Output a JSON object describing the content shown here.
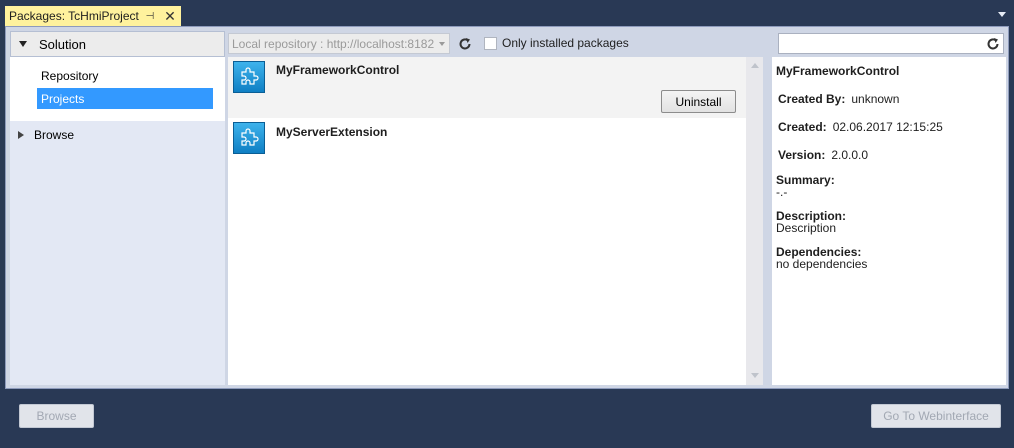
{
  "tab": {
    "title": "Packages: TcHmiProject",
    "pin_glyph": "⊣",
    "close_glyph": "✕"
  },
  "nav": {
    "solution_label": "Solution",
    "children": [
      {
        "label": "Repository",
        "selected": false
      },
      {
        "label": "Projects",
        "selected": true
      }
    ],
    "browse_label": "Browse"
  },
  "toolbar": {
    "repository_value": "Local repository : http://localhost:8182",
    "only_installed_label": "Only installed packages",
    "only_installed_checked": false
  },
  "packages": [
    {
      "name": "MyFrameworkControl",
      "selected": true,
      "action_label": "Uninstall"
    },
    {
      "name": "MyServerExtension",
      "selected": false
    }
  ],
  "details": {
    "search_value": "",
    "title": "MyFrameworkControl",
    "created_by_label": "Created By:",
    "created_by": "unknown",
    "created_label": "Created:",
    "created": "02.06.2017 12:15:25",
    "version_label": "Version:",
    "version": "2.0.0.0",
    "summary_label": "Summary:",
    "summary": "-.-",
    "description_label": "Description:",
    "description": "Description",
    "dependencies_label": "Dependencies:",
    "dependencies": "no dependencies"
  },
  "footer": {
    "browse_label": "Browse",
    "web_label": "Go To Webinterface"
  },
  "colors": {
    "frame": "#293955",
    "tab_active": "#fff29d",
    "selection": "#3399ff",
    "panel": "#cfd6e5",
    "package_icon": "#1f93d6"
  }
}
